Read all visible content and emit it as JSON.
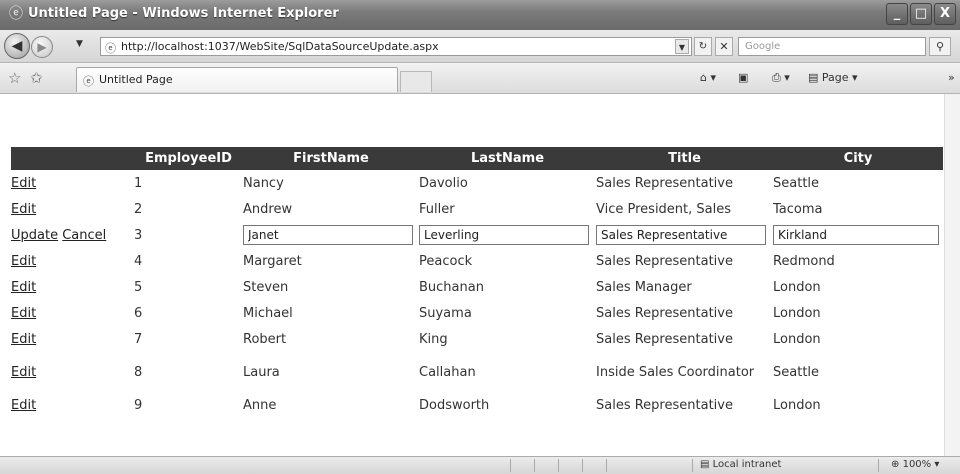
{
  "window": {
    "title": "Untitled Page - Windows Internet Explorer",
    "minimize": "_",
    "maximize": "□",
    "close": "X"
  },
  "address": {
    "url": "http://localhost:1037/WebSite/SqlDataSourceUpdate.aspx",
    "search_placeholder": "Google"
  },
  "tab": {
    "label": "Untitled Page"
  },
  "commands": {
    "page_label": "Page"
  },
  "grid": {
    "columns": [
      "",
      "EmployeeID",
      "FirstName",
      "LastName",
      "Title",
      "City"
    ],
    "edit_label": "Edit",
    "update_label": "Update",
    "cancel_label": "Cancel",
    "rows": [
      {
        "id": "1",
        "first": "Nancy",
        "last": "Davolio",
        "title": "Sales Representative",
        "city": "Seattle"
      },
      {
        "id": "2",
        "first": "Andrew",
        "last": "Fuller",
        "title": "Vice President, Sales",
        "city": "Tacoma"
      },
      {
        "id": "3",
        "first": "Janet",
        "last": "Leverling",
        "title": "Sales Representative",
        "city": "Kirkland"
      },
      {
        "id": "4",
        "first": "Margaret",
        "last": "Peacock",
        "title": "Sales Representative",
        "city": "Redmond"
      },
      {
        "id": "5",
        "first": "Steven",
        "last": "Buchanan",
        "title": "Sales Manager",
        "city": "London"
      },
      {
        "id": "6",
        "first": "Michael",
        "last": "Suyama",
        "title": "Sales Representative",
        "city": "London"
      },
      {
        "id": "7",
        "first": "Robert",
        "last": "King",
        "title": "Sales Representative",
        "city": "London"
      },
      {
        "id": "8",
        "first": "Laura",
        "last": "Callahan",
        "title": "Inside Sales Coordinator",
        "city": "Seattle"
      },
      {
        "id": "9",
        "first": "Anne",
        "last": "Dodsworth",
        "title": "Sales Representative",
        "city": "London"
      }
    ]
  },
  "status": {
    "zone": "Local intranet",
    "zoom": "100%"
  },
  "colors": {
    "header_bg": "#3a3a3a",
    "header_fg": "#ffffff"
  }
}
